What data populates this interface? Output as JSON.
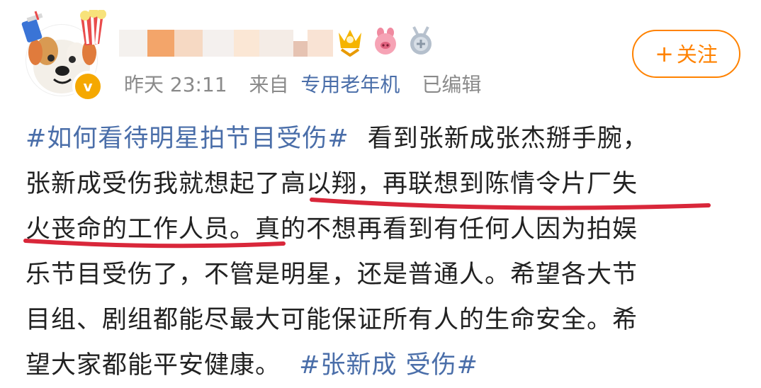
{
  "post": {
    "timestamp": "昨天 23:11",
    "source_prefix": "来自",
    "source": "专用老年机",
    "edited": "已编辑",
    "follow_label": "关注",
    "follow_plus": "+",
    "verified_mark": "v",
    "lines": [
      {
        "topic": "#如何看待明星拍节目受伤#",
        "text": "看到张新成张杰掰手腕，"
      },
      {
        "text": "张新成受伤我就想起了高以翔，再联想到陈情令片厂失"
      },
      {
        "text": "火丧命的工作人员。真的不想再看到有任何人因为拍娱"
      },
      {
        "text": "乐节目受伤了，不管是明星，还是普通人。希望各大节"
      },
      {
        "text": "目组、剧组都能尽最大可能保证所有人的生命安全。希"
      },
      {
        "text": "望大家都能平安健康。",
        "topic_end": "#张新成 受伤#"
      }
    ]
  },
  "colors": {
    "accent": "#ff8200",
    "link": "#4a6ea9",
    "meta": "#8a8a8a",
    "underline": "#d9273a",
    "text": "#222222"
  },
  "icons": [
    "dog-avatar-icon",
    "verified-icon",
    "vip-crown-icon",
    "pig-fan-icon",
    "medal-icon",
    "plus-icon"
  ]
}
